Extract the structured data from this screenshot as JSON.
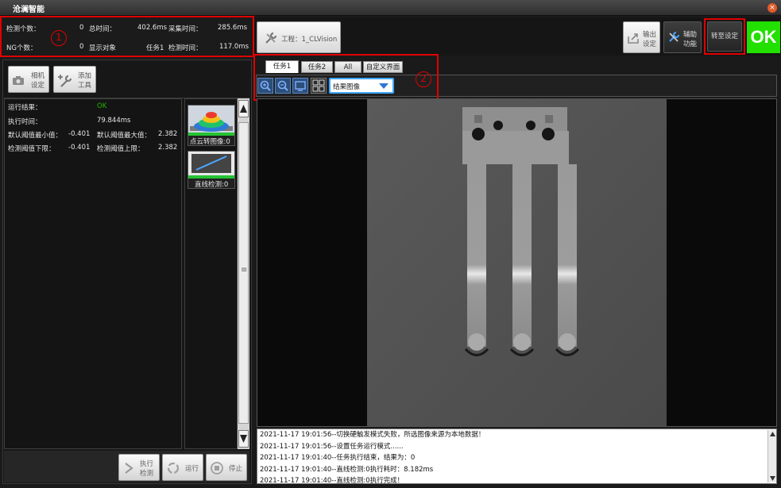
{
  "window": {
    "title": "沧澜智能",
    "close_glyph": "×"
  },
  "stats": {
    "detect_count_label": "检测个数：",
    "detect_count_value": "0",
    "total_time_label": "总时间：",
    "total_time_value": "402.6ms",
    "capture_time_label": "采集时间：",
    "capture_time_value": "285.6ms",
    "ng_count_label": "NG个数：",
    "ng_count_value": "0",
    "display_object_label": "显示对象",
    "task_label": "任务1",
    "detect_time_label": "检测时间：",
    "detect_time_value": "117.0ms",
    "annotation": "1"
  },
  "toolbar": {
    "project_label": "工程：1_CLVision",
    "output_settings_line1": "输出",
    "output_settings_line2": "设定",
    "aux_line1": "辅助",
    "aux_line2": "功能",
    "goto_settings": "转至设定",
    "ok_status": "OK",
    "ok_color": "#22e000"
  },
  "left_panel": {
    "camera_line1": "相机",
    "camera_line2": "设定",
    "add_tool_line1": "添加",
    "add_tool_line2": "工具",
    "results": {
      "run_result_label": "运行结果：",
      "run_result_value": "OK",
      "run_result_color": "#22b800",
      "exec_time_label": "执行时间：",
      "exec_time_value": "79.844ms",
      "default_min_label": "默认阈值最小值：",
      "default_min_value": "-0.401",
      "default_max_label": "默认阈值最大值：",
      "default_max_value": "2.382",
      "lower_label": "检测阈值下限：",
      "lower_value": "-0.401",
      "upper_label": "检测阈值上限：",
      "upper_value": "2.382"
    },
    "tools": [
      {
        "label": "点云转图像:0",
        "icon": "point-cloud-icon"
      },
      {
        "label": "直线检测:0",
        "icon": "line-detect-icon"
      }
    ],
    "scroll_grip": "≡",
    "bottom_buttons": {
      "exec_line1": "执行",
      "exec_line2": "检测",
      "run": "运行",
      "stop": "停止"
    }
  },
  "tabs": {
    "items": [
      "任务1",
      "任务2",
      "All",
      "自定义界面"
    ],
    "active_index": 0,
    "view_select": "结果图像",
    "annotation": "2"
  },
  "log": {
    "lines": [
      "2021-11-17 19:01:56--切换硬触发模式失败，所选图像来源为本地数据！",
      "2021-11-17 19:01:56--设置任务运行模式......",
      "2021-11-17 19:01:40--任务执行结束，结果为：0",
      "2021-11-17 19:01:40--直线检测:0执行耗时：8.182ms",
      "2021-11-17 19:01:40--直线检测:0执行完成！"
    ]
  }
}
